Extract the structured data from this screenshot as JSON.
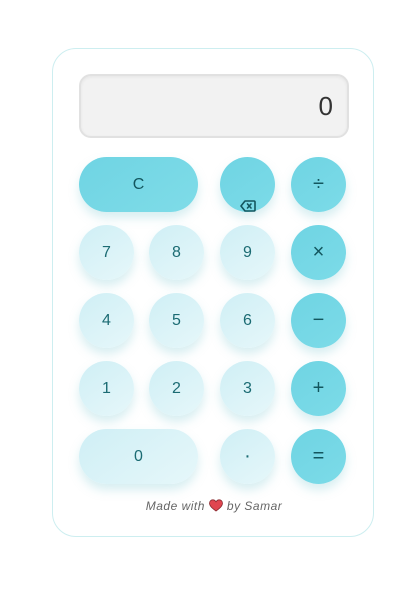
{
  "display": {
    "value": "0"
  },
  "keys": {
    "clear": "C",
    "backspace_icon": "backspace-icon",
    "divide": "÷",
    "seven": "7",
    "eight": "8",
    "nine": "9",
    "multiply": "×",
    "four": "4",
    "five": "5",
    "six": "6",
    "minus": "−",
    "one": "1",
    "two": "2",
    "three": "3",
    "plus": "+",
    "zero": "0",
    "dot": "·",
    "equals": "="
  },
  "footer": {
    "before": "Made with",
    "heart_icon": "heart-icon",
    "after": "by Samar"
  },
  "colors": {
    "accent": "#6fd4e3",
    "number_key": "#d8f3f8",
    "key_text": "#1b6b73",
    "heart": "#e0454f"
  }
}
